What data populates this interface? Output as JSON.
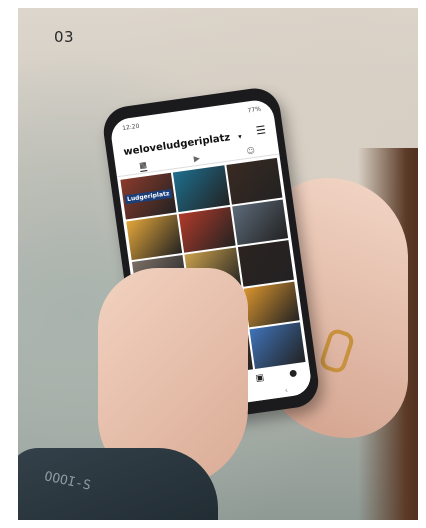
{
  "page_number": "03",
  "phone_screen": {
    "status_time": "12:20",
    "status_battery": "77%",
    "username": "weloveludgeriplatz",
    "chevron_icon": "chevron-down-icon",
    "menu_icon": "hamburger-menu-icon",
    "tabs": [
      {
        "icon": "grid-icon",
        "active": true
      },
      {
        "icon": "reels-icon",
        "active": false
      },
      {
        "icon": "tagged-icon",
        "active": false
      }
    ],
    "tiles": [
      {
        "color": "#8a3a2c",
        "label": "Ludgeriplatz"
      },
      {
        "color": "#1d6f8e",
        "label": ""
      },
      {
        "color": "#3a2a22",
        "label": ""
      },
      {
        "color": "#e3a63a",
        "label": ""
      },
      {
        "color": "#b13a2a",
        "label": ""
      },
      {
        "color": "#5c6a78",
        "label": ""
      },
      {
        "color": "#7b6f66",
        "label": ""
      },
      {
        "color": "#caa04c",
        "label": ""
      },
      {
        "color": "#2b2320",
        "label": ""
      },
      {
        "color": "#4a7fae",
        "label": ""
      },
      {
        "color": "#8c96a8",
        "label": ""
      },
      {
        "color": "#d9942e",
        "label": ""
      },
      {
        "color": "#e08a4c",
        "label": ""
      },
      {
        "color": "#6b3f2a",
        "label": ""
      },
      {
        "color": "#3f73b8",
        "label": ""
      }
    ],
    "bottom_nav": [
      {
        "icon": "home-icon"
      },
      {
        "icon": "search-icon"
      },
      {
        "icon": "add-post-icon"
      },
      {
        "icon": "shop-icon"
      },
      {
        "icon": "profile-icon"
      }
    ],
    "system_nav": [
      {
        "icon": "recent-apps-icon"
      },
      {
        "icon": "home-circle-icon"
      },
      {
        "icon": "back-icon"
      }
    ]
  },
  "sleeve_print": "OOOI-S"
}
